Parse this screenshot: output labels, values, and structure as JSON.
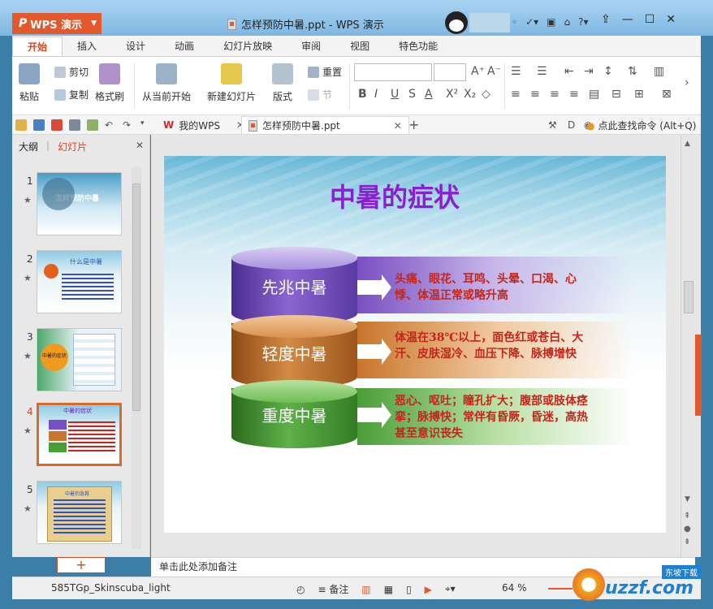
{
  "app": {
    "name": "WPS 演示",
    "title": "怎样预防中暑.ppt - WPS 演示"
  },
  "menu": [
    "开始",
    "插入",
    "设计",
    "动画",
    "幻灯片放映",
    "审阅",
    "视图",
    "特色功能"
  ],
  "ribbon": {
    "paste": "粘贴",
    "cut": "剪切",
    "copy": "复制",
    "format": "格式刷",
    "from_current": "从当前开始",
    "new_slide": "新建幻灯片",
    "layout": "版式",
    "reset": "重置",
    "section": "节"
  },
  "doctabs": [
    {
      "label": "我的WPS"
    },
    {
      "label": "怎样预防中暑.ppt"
    }
  ],
  "search": "点此查找命令 (Alt+Q)",
  "panel": {
    "outline": "大纲",
    "slides": "幻灯片",
    "sep": "|"
  },
  "slides": [
    {
      "num": "1"
    },
    {
      "num": "2"
    },
    {
      "num": "3"
    },
    {
      "num": "4"
    },
    {
      "num": "5"
    }
  ],
  "thumb_titles": {
    "s1": "怎样预防中暑",
    "s2": "什么是中暑",
    "s3": "中暑的症状",
    "s4": "中暑的症状",
    "s5": "中暑的急救"
  },
  "slide": {
    "title": "中暑的症状",
    "levels": [
      {
        "name": "先兆中暑",
        "text": "头痛、眼花、耳鸣、头晕、口渴、心悸、体温正常或略升高",
        "color": "#7a4fc2"
      },
      {
        "name": "轻度中暑",
        "text": "体温在38℃以上，面色红或苍白、大汗、皮肤湿冷、血压下降、脉搏增快",
        "color": "#c9752a"
      },
      {
        "name": "重度中暑",
        "text": "恶心、呕吐；瞳孔扩大；腹部或肢体痉挛；脉搏快；常伴有昏厥，昏迷，高热甚至意识丧失",
        "color": "#4a9e38"
      }
    ]
  },
  "notes": "单击此处添加备注",
  "status": {
    "theme": "585TGp_Skinscuba_light",
    "notes_btn": "备注",
    "zoom": "64 %"
  },
  "watermark": {
    "brand": "uzzf.com",
    "sub": "东坡下载"
  }
}
